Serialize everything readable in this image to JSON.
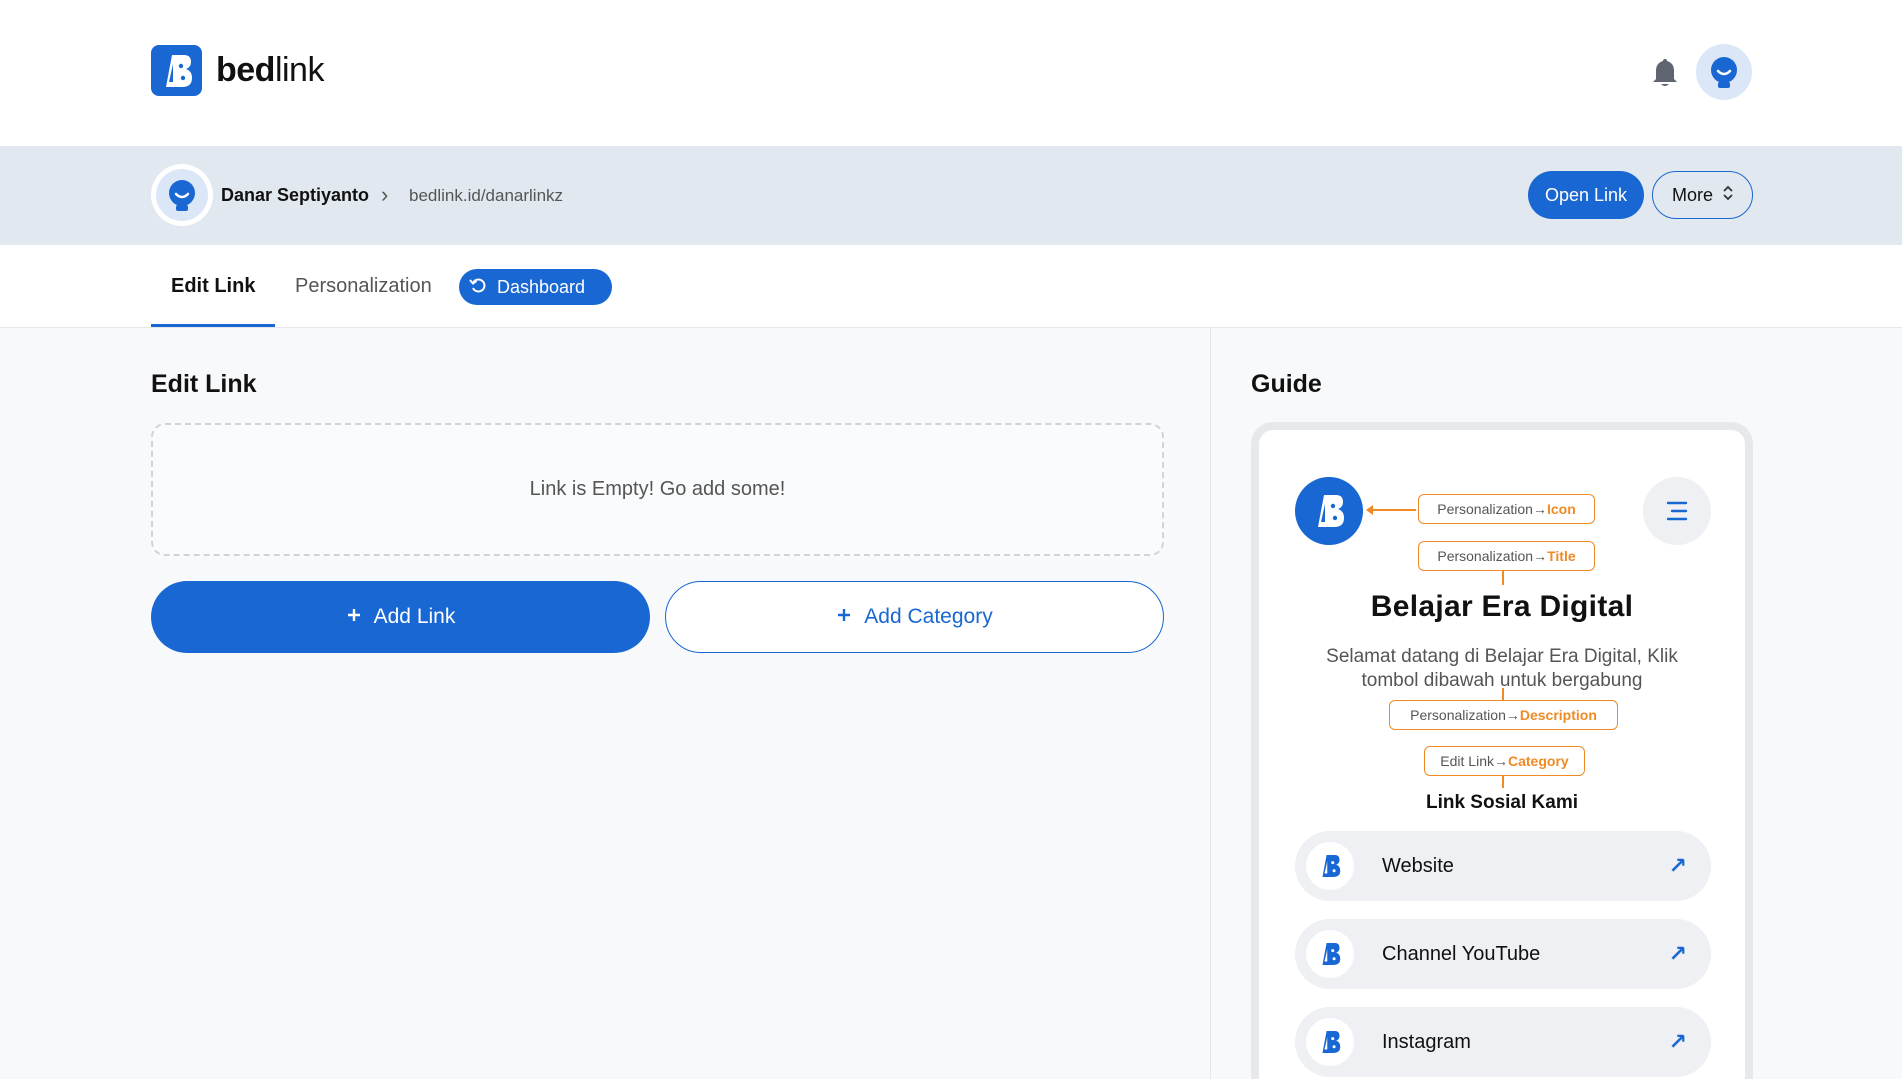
{
  "brand": {
    "name_bold": "bed",
    "name_light": "link"
  },
  "profile": {
    "name": "Danar Septiyanto",
    "url": "bedlink.id/danarlinkz"
  },
  "actions": {
    "open_link": "Open Link",
    "more": "More"
  },
  "tabs": {
    "edit_link": "Edit Link",
    "personalization": "Personalization",
    "dashboard": "Dashboard"
  },
  "editor": {
    "title": "Edit Link",
    "empty_message": "Link is Empty! Go add some!",
    "add_link": "Add Link",
    "add_category": "Add Category"
  },
  "guide": {
    "title": "Guide",
    "callouts": {
      "icon_prefix": "Personalization→",
      "icon_key": "Icon",
      "title_prefix": "Personalization→",
      "title_key": "Title",
      "desc_prefix": "Personalization→",
      "desc_key": "Description",
      "cat_prefix": "Edit Link→",
      "cat_key": "Category"
    },
    "page_title": "Belajar Era Digital",
    "page_description": "Selamat datang di Belajar Era Digital, Klik tombol dibawah untuk bergabung",
    "category_name": "Link Sosial Kami",
    "links": [
      {
        "label": "Website"
      },
      {
        "label": "Channel YouTube"
      },
      {
        "label": "Instagram"
      }
    ]
  },
  "colors": {
    "accent": "#1967d2",
    "callout": "#f08a24",
    "profile_bar": "#e2e8f0"
  },
  "icons": [
    "bedlink-logo-icon",
    "bell-icon",
    "avatar-icon",
    "chevron-right-icon",
    "chevron-updown-icon",
    "undo-icon",
    "plus-icon",
    "menu-icon",
    "arrow-up-right-icon"
  ]
}
